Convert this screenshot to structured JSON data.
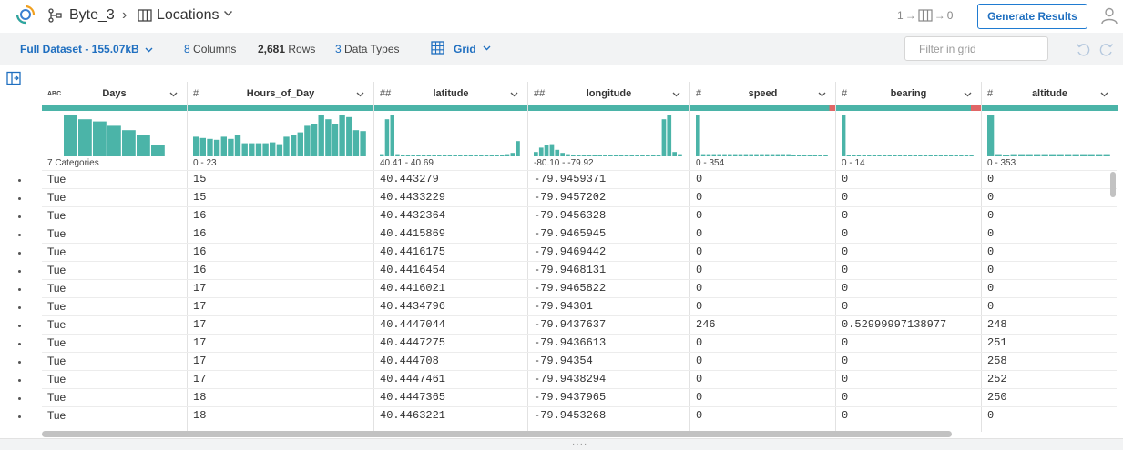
{
  "header": {
    "flow_name": "Byte_3",
    "dataset_name": "Locations",
    "lineage_left": "1",
    "lineage_right": "0",
    "generate_label": "Generate Results"
  },
  "toolbar": {
    "dataset_label": "Full Dataset - 155.07kB",
    "columns_count": "8",
    "columns_label": "Columns",
    "rows_count": "2,681",
    "rows_label": "Rows",
    "types_count": "3",
    "types_label": "Data Types",
    "view_label": "Grid",
    "filter_placeholder": "Filter in grid"
  },
  "colors": {
    "accent": "#1f6fc0",
    "histogram": "#4bb4a8",
    "mismatch": "#e06666"
  },
  "columns": [
    {
      "type": "ABC",
      "name": "Days",
      "range": "7 Categories",
      "mismatch": 0,
      "hist": [
        0.95,
        0.85,
        0.8,
        0.7,
        0.6,
        0.5,
        0.25
      ]
    },
    {
      "type": "#",
      "name": "Hours_of_Day",
      "range": "0 - 23",
      "hist": [
        0.45,
        0.42,
        0.4,
        0.38,
        0.45,
        0.4,
        0.5,
        0.3,
        0.3,
        0.3,
        0.3,
        0.32,
        0.28,
        0.45,
        0.5,
        0.55,
        0.7,
        0.75,
        0.95,
        0.85,
        0.75,
        0.95,
        0.9,
        0.6,
        0.58
      ]
    },
    {
      "type": "##",
      "name": "latitude",
      "range": "40.41 - 40.69",
      "hist": [
        0.05,
        0.85,
        0.95,
        0.05,
        0.03,
        0.02,
        0.02,
        0.02,
        0.02,
        0.02,
        0.02,
        0.02,
        0.02,
        0.02,
        0.02,
        0.02,
        0.02,
        0.02,
        0.02,
        0.02,
        0.02,
        0.02,
        0.02,
        0.02,
        0.05,
        0.08,
        0.35
      ]
    },
    {
      "type": "##",
      "name": "longitude",
      "range": "-80.10 - -79.92",
      "hist": [
        0.1,
        0.2,
        0.25,
        0.28,
        0.15,
        0.08,
        0.05,
        0.03,
        0.03,
        0.02,
        0.02,
        0.02,
        0.02,
        0.02,
        0.02,
        0.02,
        0.02,
        0.02,
        0.02,
        0.02,
        0.02,
        0.02,
        0.02,
        0.02,
        0.85,
        0.95,
        0.1,
        0.05
      ]
    },
    {
      "type": "#",
      "name": "speed",
      "range": "0 - 354",
      "mismatch": 0.04,
      "hist": [
        0.95,
        0.05,
        0.05,
        0.05,
        0.05,
        0.05,
        0.05,
        0.05,
        0.05,
        0.05,
        0.05,
        0.05,
        0.05,
        0.05,
        0.05,
        0.05,
        0.05,
        0.05,
        0.04,
        0.04,
        0.03,
        0.03,
        0.03,
        0.03,
        0.02
      ]
    },
    {
      "type": "#",
      "name": "bearing",
      "range": "0 - 14",
      "mismatch": 0.07,
      "hist": [
        0.95,
        0.03,
        0.03,
        0.03,
        0.03,
        0.03,
        0.03,
        0.03,
        0.03,
        0.03,
        0.03,
        0.03,
        0.03,
        0.03,
        0.03,
        0.03,
        0.03,
        0.03,
        0.03,
        0.03,
        0.03,
        0.03,
        0.03,
        0.03,
        0.03,
        0.03
      ]
    },
    {
      "type": "#",
      "name": "altitude",
      "range": "0 - 353",
      "hist": [
        0.95,
        0.05,
        0.03,
        0.05,
        0.05,
        0.05,
        0.05,
        0.05,
        0.05,
        0.05,
        0.05,
        0.05,
        0.05,
        0.05,
        0.05,
        0.05
      ]
    }
  ],
  "rows": [
    [
      "Tue",
      "15",
      "40.443279",
      "-79.9459371",
      "0",
      "0",
      "0"
    ],
    [
      "Tue",
      "15",
      "40.4433229",
      "-79.9457202",
      "0",
      "0",
      "0"
    ],
    [
      "Tue",
      "16",
      "40.4432364",
      "-79.9456328",
      "0",
      "0",
      "0"
    ],
    [
      "Tue",
      "16",
      "40.4415869",
      "-79.9465945",
      "0",
      "0",
      "0"
    ],
    [
      "Tue",
      "16",
      "40.4416175",
      "-79.9469442",
      "0",
      "0",
      "0"
    ],
    [
      "Tue",
      "16",
      "40.4416454",
      "-79.9468131",
      "0",
      "0",
      "0"
    ],
    [
      "Tue",
      "17",
      "40.4416021",
      "-79.9465822",
      "0",
      "0",
      "0"
    ],
    [
      "Tue",
      "17",
      "40.4434796",
      "-79.94301",
      "0",
      "0",
      "0"
    ],
    [
      "Tue",
      "17",
      "40.4447044",
      "-79.9437637",
      "246",
      "0.52999997138977",
      "248"
    ],
    [
      "Tue",
      "17",
      "40.4447275",
      "-79.9436613",
      "0",
      "0",
      "251"
    ],
    [
      "Tue",
      "17",
      "40.444708",
      "-79.94354",
      "0",
      "0",
      "258"
    ],
    [
      "Tue",
      "17",
      "40.4447461",
      "-79.9438294",
      "0",
      "0",
      "252"
    ],
    [
      "Tue",
      "18",
      "40.4447365",
      "-79.9437965",
      "0",
      "0",
      "250"
    ],
    [
      "Tue",
      "18",
      "40.4463221",
      "-79.9453268",
      "0",
      "0",
      "0"
    ]
  ]
}
